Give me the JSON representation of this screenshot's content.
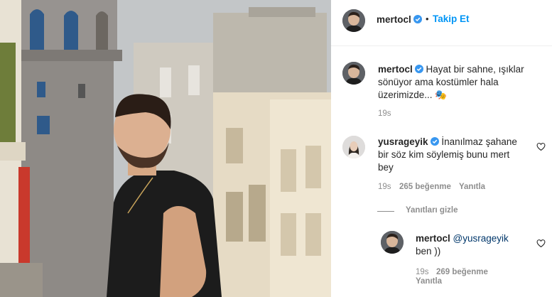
{
  "post": {
    "author": "mertocl",
    "follow_label": "Takip Et",
    "separator": "•"
  },
  "caption": {
    "author": "mertocl",
    "text": "Hayat bir sahne, ışıklar sönüyor ama kostümler hala üzerimizde... 🎭",
    "time": "19s"
  },
  "comment1": {
    "author": "yusrageyik",
    "text": "İnanılmaz şahane bir söz kim söylemiş bunu mert bey",
    "time": "19s",
    "likes": "265 beğenme",
    "reply_label": "Yanıtla"
  },
  "replies_toggle": "Yanıtları gizle",
  "reply1": {
    "author": "mertocl",
    "mention": "@yusrageyik",
    "text": "ben ))",
    "time": "19s",
    "likes": "269 beğenme",
    "reply_label": "Yanıtla"
  },
  "icons": {
    "verified": "verified-badge-icon",
    "heart": "heart-outline-icon"
  },
  "colors": {
    "link_blue": "#0095f6",
    "verified_blue": "#3897f0",
    "meta_gray": "#8e8e8e",
    "text": "#262626"
  }
}
